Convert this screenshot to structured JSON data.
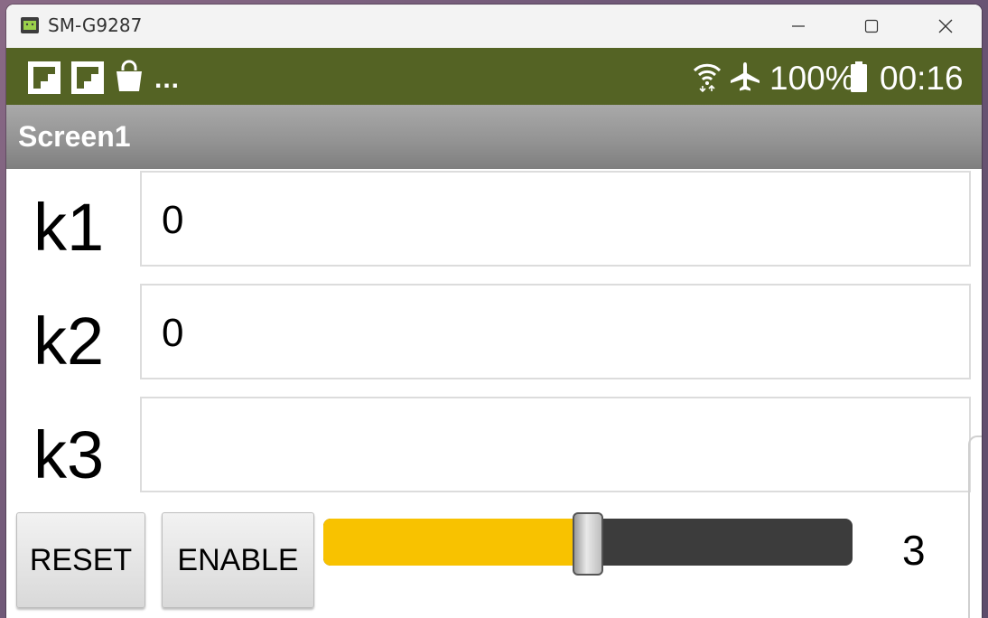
{
  "window": {
    "title": "SM-G9287",
    "icon": "android-icon",
    "controls": [
      "minimize-icon",
      "maximize-icon",
      "close-icon"
    ]
  },
  "status_bar": {
    "left_icons": [
      "flipboard-icon",
      "flipboard-icon",
      "shopping-bag-icon"
    ],
    "more": "...",
    "right_icons": [
      "wifi-icon",
      "airplane-mode-icon",
      "battery-icon"
    ],
    "battery": "100%",
    "time": "00:16",
    "color": "#546324"
  },
  "app_bar": {
    "title": "Screen1"
  },
  "rows": [
    {
      "label": "k1",
      "value": "0"
    },
    {
      "label": "k2",
      "value": "0"
    },
    {
      "label": "k3",
      "value": ""
    }
  ],
  "buttons": {
    "reset": "RESET",
    "enable": "ENABLE"
  },
  "slider": {
    "value": "3",
    "fill_fraction": 0.5,
    "fill_color": "#f8c200"
  }
}
